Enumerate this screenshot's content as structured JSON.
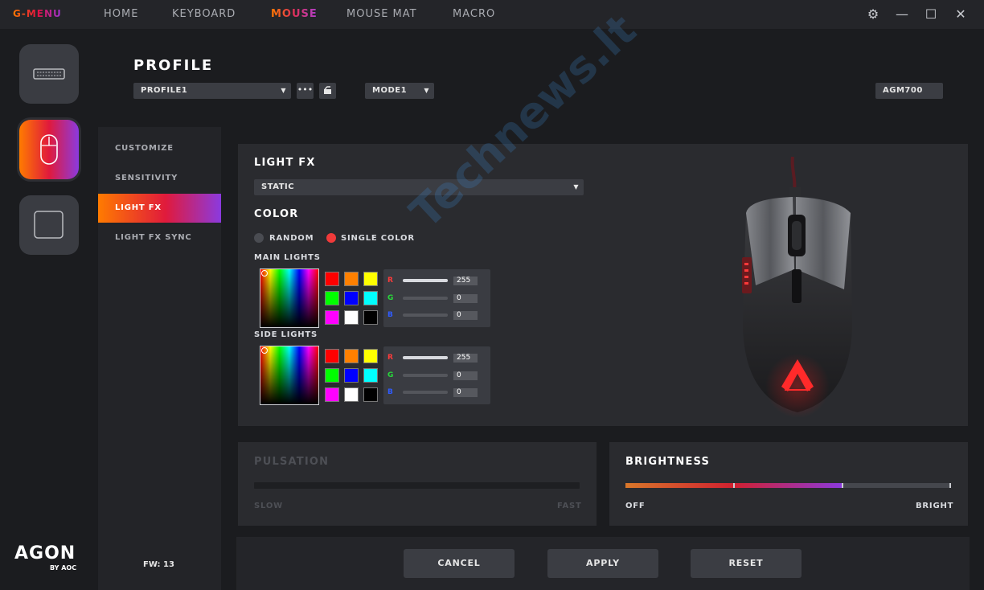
{
  "app": {
    "logo": "G-MENU",
    "nav": [
      "HOME",
      "KEYBOARD",
      "MOUSE",
      "MOUSE MAT",
      "MACRO"
    ],
    "active_nav": "MOUSE"
  },
  "header": {
    "title": "PROFILE",
    "profile_select": "PROFILE1",
    "more_label": "•••",
    "mode_select": "MODE1",
    "device": "AGM700"
  },
  "subnav": {
    "items": [
      "CUSTOMIZE",
      "SENSITIVITY",
      "LIGHT FX",
      "LIGHT FX SYNC"
    ],
    "active": "LIGHT FX",
    "fw": "FW: 13"
  },
  "brand": {
    "name": "AGON",
    "by": "BY AOC"
  },
  "lightfx": {
    "title": "LIGHT FX",
    "effect": "STATIC",
    "color_title": "COLOR",
    "radio_random": "RANDOM",
    "radio_single": "SINGLE COLOR",
    "selected": "SINGLE COLOR",
    "main_label": "MAIN LIGHTS",
    "side_label": "SIDE LIGHTS",
    "swatches": [
      "#ff0000",
      "#ff8000",
      "#ffff00",
      "#00ff00",
      "#0000ff",
      "#00ffff",
      "#ff00ff",
      "#ffffff",
      "#000000"
    ],
    "main_rgb": {
      "r": "255",
      "g": "0",
      "b": "0"
    },
    "side_rgb": {
      "r": "255",
      "g": "0",
      "b": "0"
    },
    "rgb_letters": {
      "r": "R",
      "g": "G",
      "b": "B"
    }
  },
  "pulsation": {
    "title": "PULSATION",
    "min": "SLOW",
    "max": "FAST"
  },
  "brightness": {
    "title": "BRIGHTNESS",
    "min": "OFF",
    "max": "BRIGHT",
    "level_fraction": 0.67
  },
  "actions": {
    "cancel": "CANCEL",
    "apply": "APPLY",
    "reset": "RESET"
  },
  "watermark": "Technews.lt",
  "colors": {
    "accent_orange": "#ff7b00",
    "accent_red": "#e01a3c",
    "accent_purple": "#8b3adf"
  }
}
